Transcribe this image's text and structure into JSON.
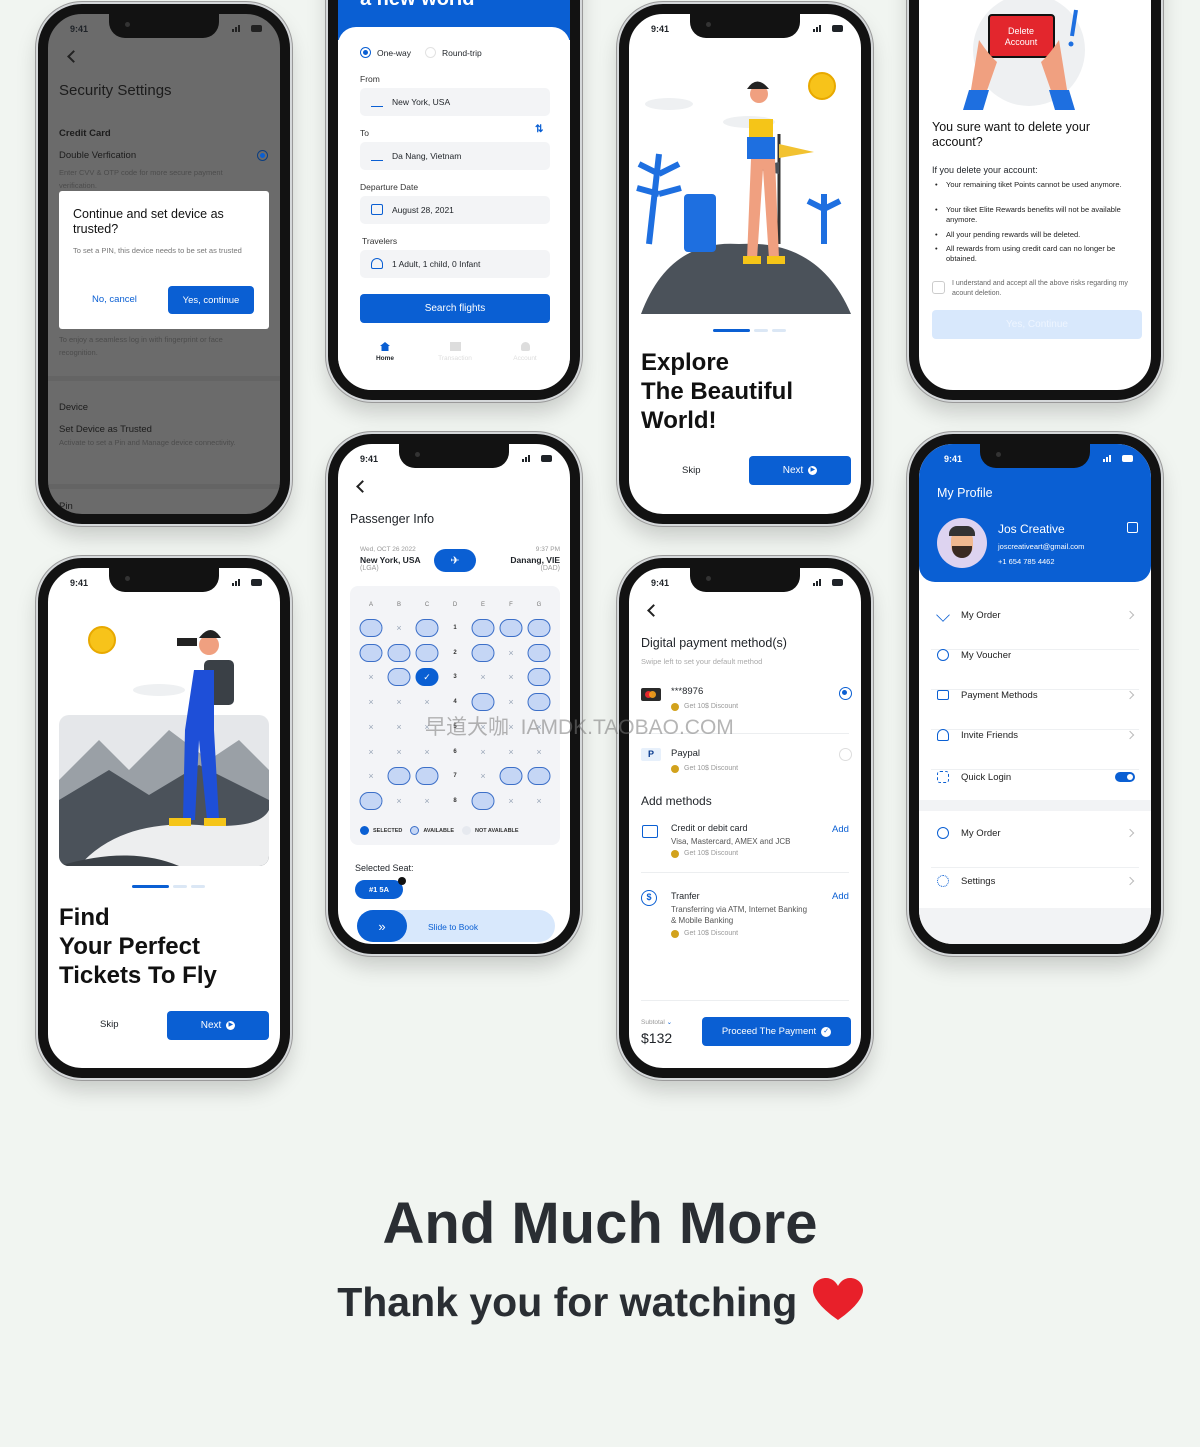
{
  "status_time": "9:41",
  "colors": {
    "accent": "#0a5fd3",
    "background": "#f1f5f1",
    "heart": "#e8202a",
    "overlay": "#6b6b6b"
  },
  "security": {
    "title": "Security Settings",
    "credit_card": "Credit Card",
    "double_verification": "Double Verfication",
    "double_verification_desc": "Enter CVV & OTP code for more secure payment verification.",
    "double_verification_on": true,
    "biometric_desc": "To enjoy a seamless log in with fingerprint or face recognition.",
    "device": "Device",
    "trusted_title": "Set Device as Trusted",
    "trusted_desc": "Activate to set a Pin and Manage device connectivity.",
    "pin": "Pin",
    "dialog": {
      "title": "Continue and set device as trusted?",
      "body": "To set a PIN, this device needs to be set as trusted",
      "cancel": "No, cancel",
      "confirm": "Yes, continue"
    }
  },
  "flights": {
    "header_title": "a new world",
    "one_way": "One-way",
    "round_trip": "Round-trip",
    "trip_type": "One-way",
    "from_label": "From",
    "from_value": "New York, USA",
    "to_label": "To",
    "to_value": "Da Nang, Vietnam",
    "date_label": "Departure Date",
    "date_value": "August 28, 2021",
    "travelers_label": "Travelers",
    "travelers_value": "1 Adult, 1 child, 0 Infant",
    "search": "Search flights",
    "tabs": [
      {
        "label": "Home",
        "icon": "home-icon",
        "active": true
      },
      {
        "label": "Transaction",
        "icon": "receipt-icon"
      },
      {
        "label": "Account",
        "icon": "user-icon"
      }
    ]
  },
  "explore": {
    "title_lines": [
      "Explore",
      "The Beautiful",
      "World!"
    ],
    "skip": "Skip",
    "next": "Next",
    "page": 1,
    "pages": 3
  },
  "delete": {
    "card_text": "Delete Account",
    "question": "You sure want to delete your account?",
    "intro": "If you delete your account:",
    "bullets": [
      "Your remaining tiket Points cannot be used anymore.",
      "Your tiket Elite Rewards benefits will not be available anymore.",
      "All your pending rewards will be deleted.",
      "All rewards from using credit card can no longer be obtained."
    ],
    "checkbox": "I understand and accept all the above risks regarding my acount deletion.",
    "checked": false,
    "confirm": "Yes, Continue"
  },
  "find": {
    "title_lines": [
      "Find",
      "Your Perfect",
      "Tickets To Fly"
    ],
    "skip": "Skip",
    "next": "Next",
    "page": 1,
    "pages": 3
  },
  "passenger": {
    "title": "Passenger Info",
    "depart_date": "Wed, OCT 26 2022",
    "depart_city": "New York, USA",
    "depart_code": "(LGA)",
    "arrive_time": "9:37 PM",
    "arrive_city": "Danang, VIE",
    "arrive_code": "(DAD)",
    "columns": [
      "A",
      "B",
      "C",
      "D",
      "E",
      "F",
      "G"
    ],
    "seat_rows": [
      {
        "row": "1",
        "seats": "oxo ooo"
      },
      {
        "row": "2",
        "seats": "ooo oxo"
      },
      {
        "row": "3",
        "seats": "xos xxo"
      },
      {
        "row": "4",
        "seats": "xxx oxo"
      },
      {
        "row": "5",
        "seats": "xxx xxx"
      },
      {
        "row": "6",
        "seats": "xxx xxx"
      },
      {
        "row": "7",
        "seats": "xoo xoo"
      },
      {
        "row": "8",
        "seats": "oxx oxx"
      }
    ],
    "legend": [
      "SELECTED",
      "AVAILABLE",
      "NOT AVAILABLE"
    ],
    "selected_label": "Selected Seat:",
    "selected_chip": "#1  5A",
    "slide": "Slide to Book"
  },
  "payment": {
    "title": "Digital payment method(s)",
    "subtitle": "Swipe left to set your default method",
    "methods": [
      {
        "name": "***8976",
        "discount": "Get 10$ Discount",
        "selected": true,
        "icon": "mastercard-icon"
      },
      {
        "name": "Paypal",
        "discount": "Get 10$ Discount",
        "selected": false,
        "icon": "paypal-icon"
      }
    ],
    "add_title": "Add methods",
    "add_methods": [
      {
        "name": "Credit or debit card",
        "desc": "Visa, Mastercard, AMEX and JCB",
        "discount": "Get 10$ Discount",
        "action": "Add"
      },
      {
        "name": "Tranfer",
        "desc": "Transferring via ATM, Internet Banking & Mobile Banking",
        "discount": "Get 10$ Discount",
        "action": "Add"
      }
    ],
    "subtotal_label": "Subtotal",
    "subtotal": "$132",
    "proceed": "Proceed The Payment"
  },
  "profile": {
    "title": "My Profile",
    "name": "Jos Creative",
    "email": "joscreativeart@gmail.com",
    "phone": "+1 654 785 4462",
    "items": [
      {
        "label": "My Order",
        "icon": "navigation-icon"
      },
      {
        "label": "My Voucher",
        "icon": "voucher-icon"
      },
      {
        "label": "Payment Methods",
        "icon": "card-icon"
      },
      {
        "label": "Invite Friends",
        "icon": "add-user-icon"
      },
      {
        "label": "Quick Login",
        "icon": "scan-icon",
        "toggle": true
      }
    ],
    "items2": [
      {
        "label": "My Order",
        "icon": "help-icon"
      },
      {
        "label": "Settings",
        "icon": "gear-icon"
      }
    ]
  },
  "watermark": "早道大咖  IAMDK.TAOBAO.COM",
  "footer": {
    "headline": "And Much More",
    "thanks": "Thank you for watching"
  }
}
